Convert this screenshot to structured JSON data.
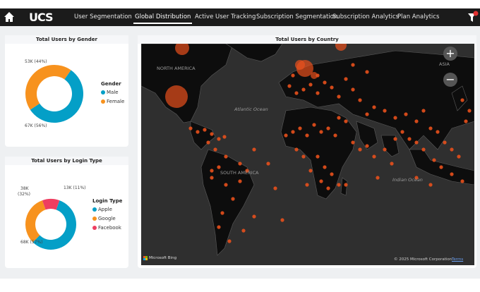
{
  "nav": {
    "logo": "UCS",
    "items": [
      "User Segmentation",
      "Global Distribution",
      "Active User Tracking",
      "Subscription Segmentation",
      "Subscription Analytics",
      "Plan Analytics"
    ],
    "active": "Global Distribution",
    "home_icon": "home-icon",
    "filter_icon": "filter-icon"
  },
  "gender": {
    "title": "Total Users by Gender",
    "legend_title": "Gender",
    "items": [
      {
        "label": "Male",
        "value": "67K (56%)",
        "pct": 56,
        "color": "#049FC7"
      },
      {
        "label": "Female",
        "value": "53K (44%)",
        "pct": 44,
        "color": "#F7921E"
      }
    ]
  },
  "login": {
    "title": "Total Users by Login Type",
    "legend_title": "Login Type",
    "items": [
      {
        "label": "Apple",
        "value": "68K (57%)",
        "pct": 57,
        "color": "#049FC7"
      },
      {
        "label": "Google",
        "value": "38K (32%)",
        "pct": 32,
        "color": "#F7921E"
      },
      {
        "label": "Facebook",
        "value": "13K (11%)",
        "pct": 11,
        "color": "#EE3E60"
      }
    ],
    "google_line1": "38K",
    "google_line2": "(32%)"
  },
  "map": {
    "title": "Total Users by Country",
    "labels": {
      "na": "NORTH AMERICA",
      "asia": "ASIA",
      "atlantic": "Atlantic Ocean",
      "sa": "SOUTH AMERICA",
      "indian": "Indian Ocean"
    },
    "zoom_in": "+",
    "zoom_out": "−",
    "bing": "Microsoft Bing",
    "copyright": "© 2025 Microsoft Corporation",
    "terms": "Terms",
    "bubble_color": "#E8501C"
  }
}
